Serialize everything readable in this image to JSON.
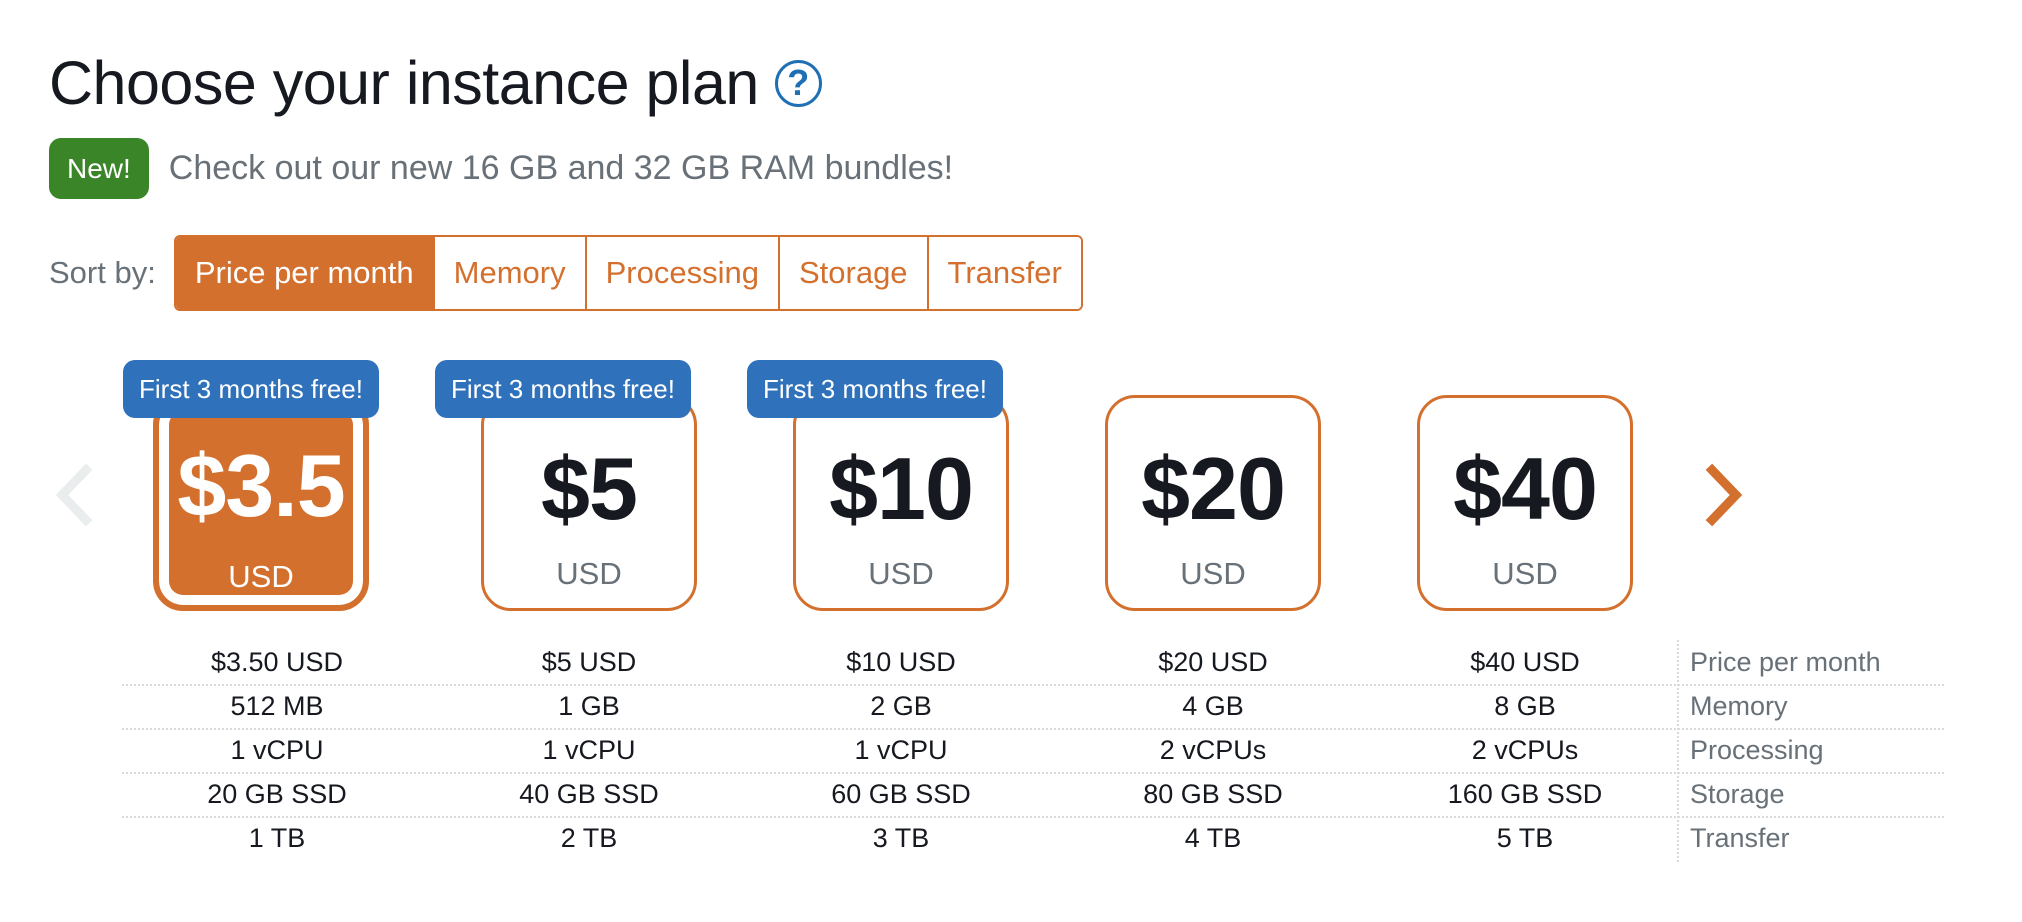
{
  "title": "Choose your instance plan",
  "help_icon": "question-circle-icon",
  "announcement": {
    "badge": "New!",
    "text": "Check out our new 16 GB and 32 GB RAM bundles!"
  },
  "sort": {
    "label": "Sort by:",
    "options": [
      "Price per month",
      "Memory",
      "Processing",
      "Storage",
      "Transfer"
    ],
    "selected": "Price per month"
  },
  "carousel": {
    "prev_icon": "chevron-left-icon",
    "next_icon": "chevron-right-icon"
  },
  "plans": [
    {
      "price": "$3.5",
      "currency": "USD",
      "promo": "First 3 months free!",
      "selected": true,
      "specs": [
        "$3.50 USD",
        "512 MB",
        "1 vCPU",
        "20 GB SSD",
        "1 TB"
      ]
    },
    {
      "price": "$5",
      "currency": "USD",
      "promo": "First 3 months free!",
      "selected": false,
      "specs": [
        "$5 USD",
        "1 GB",
        "1 vCPU",
        "40 GB SSD",
        "2 TB"
      ]
    },
    {
      "price": "$10",
      "currency": "USD",
      "promo": "First 3 months free!",
      "selected": false,
      "specs": [
        "$10 USD",
        "2 GB",
        "1 vCPU",
        "60 GB SSD",
        "3 TB"
      ]
    },
    {
      "price": "$20",
      "currency": "USD",
      "promo": "",
      "selected": false,
      "specs": [
        "$20 USD",
        "4 GB",
        "2 vCPUs",
        "80 GB SSD",
        "4 TB"
      ]
    },
    {
      "price": "$40",
      "currency": "USD",
      "promo": "",
      "selected": false,
      "specs": [
        "$40 USD",
        "8 GB",
        "2 vCPUs",
        "160 GB SSD",
        "5 TB"
      ]
    }
  ],
  "spec_labels": [
    "Price per month",
    "Memory",
    "Processing",
    "Storage",
    "Transfer"
  ],
  "colors": {
    "accent": "#d4702e",
    "promo": "#2f72bb",
    "new_badge": "#3b8529",
    "help": "#1f6fb4"
  }
}
